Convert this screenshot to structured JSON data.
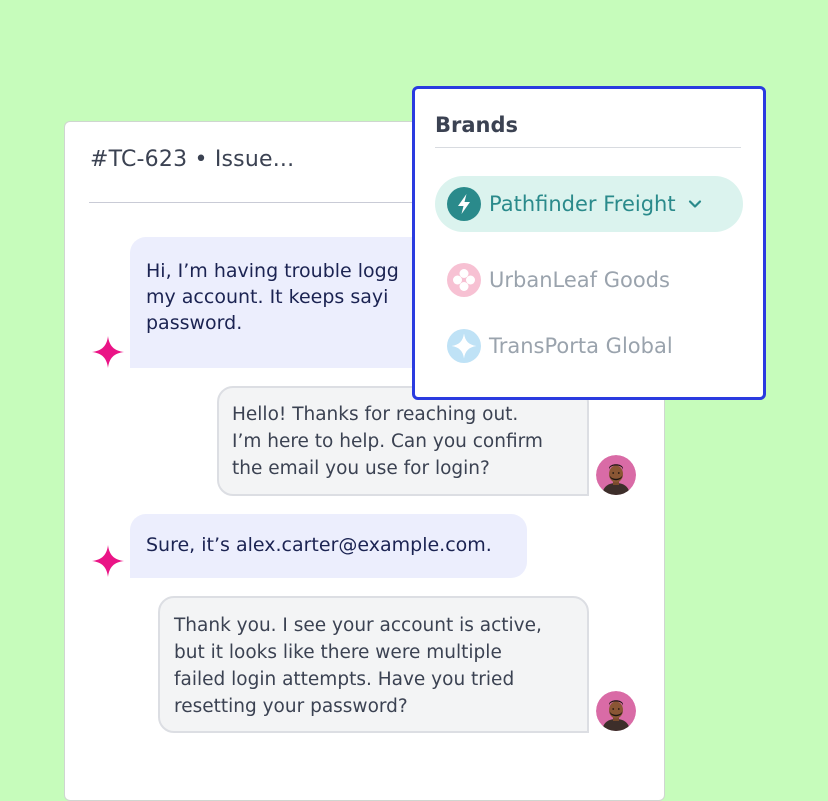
{
  "ticket": {
    "title": "#TC-623 • Issue..."
  },
  "messages": [
    {
      "sender": "user",
      "lines": [
        "Hi, I’m having trouble logg",
        "my account. It keeps sayi",
        "password."
      ]
    },
    {
      "sender": "agent",
      "lines": [
        "Hello! Thanks for reaching out.",
        "I’m here to help. Can you confirm",
        "the email you use for login?"
      ]
    },
    {
      "sender": "user",
      "lines": [
        "Sure, it’s alex.carter@example.com."
      ]
    },
    {
      "sender": "agent",
      "lines": [
        "Thank you. I see your account is active,",
        "but it looks like there were multiple",
        "failed login attempts. Have you tried",
        "resetting your password?"
      ]
    }
  ],
  "brands": {
    "heading": "Brands",
    "items": [
      {
        "label": "Pathfinder Freight",
        "icon": "lightning-icon",
        "selected": true
      },
      {
        "label": "UrbanLeaf Goods",
        "icon": "flower-icon",
        "selected": false
      },
      {
        "label": "TransPorta Global",
        "icon": "star-icon",
        "selected": false
      }
    ]
  },
  "colors": {
    "background": "#c6fcbb",
    "accent_border": "#2a3be0",
    "user_bubble": "#eceefd",
    "agent_bubble": "#f3f4f5",
    "sparkle": "#ea1486",
    "selected_brand_bg": "#dbf3ee",
    "selected_brand_text": "#2a8a8b"
  }
}
